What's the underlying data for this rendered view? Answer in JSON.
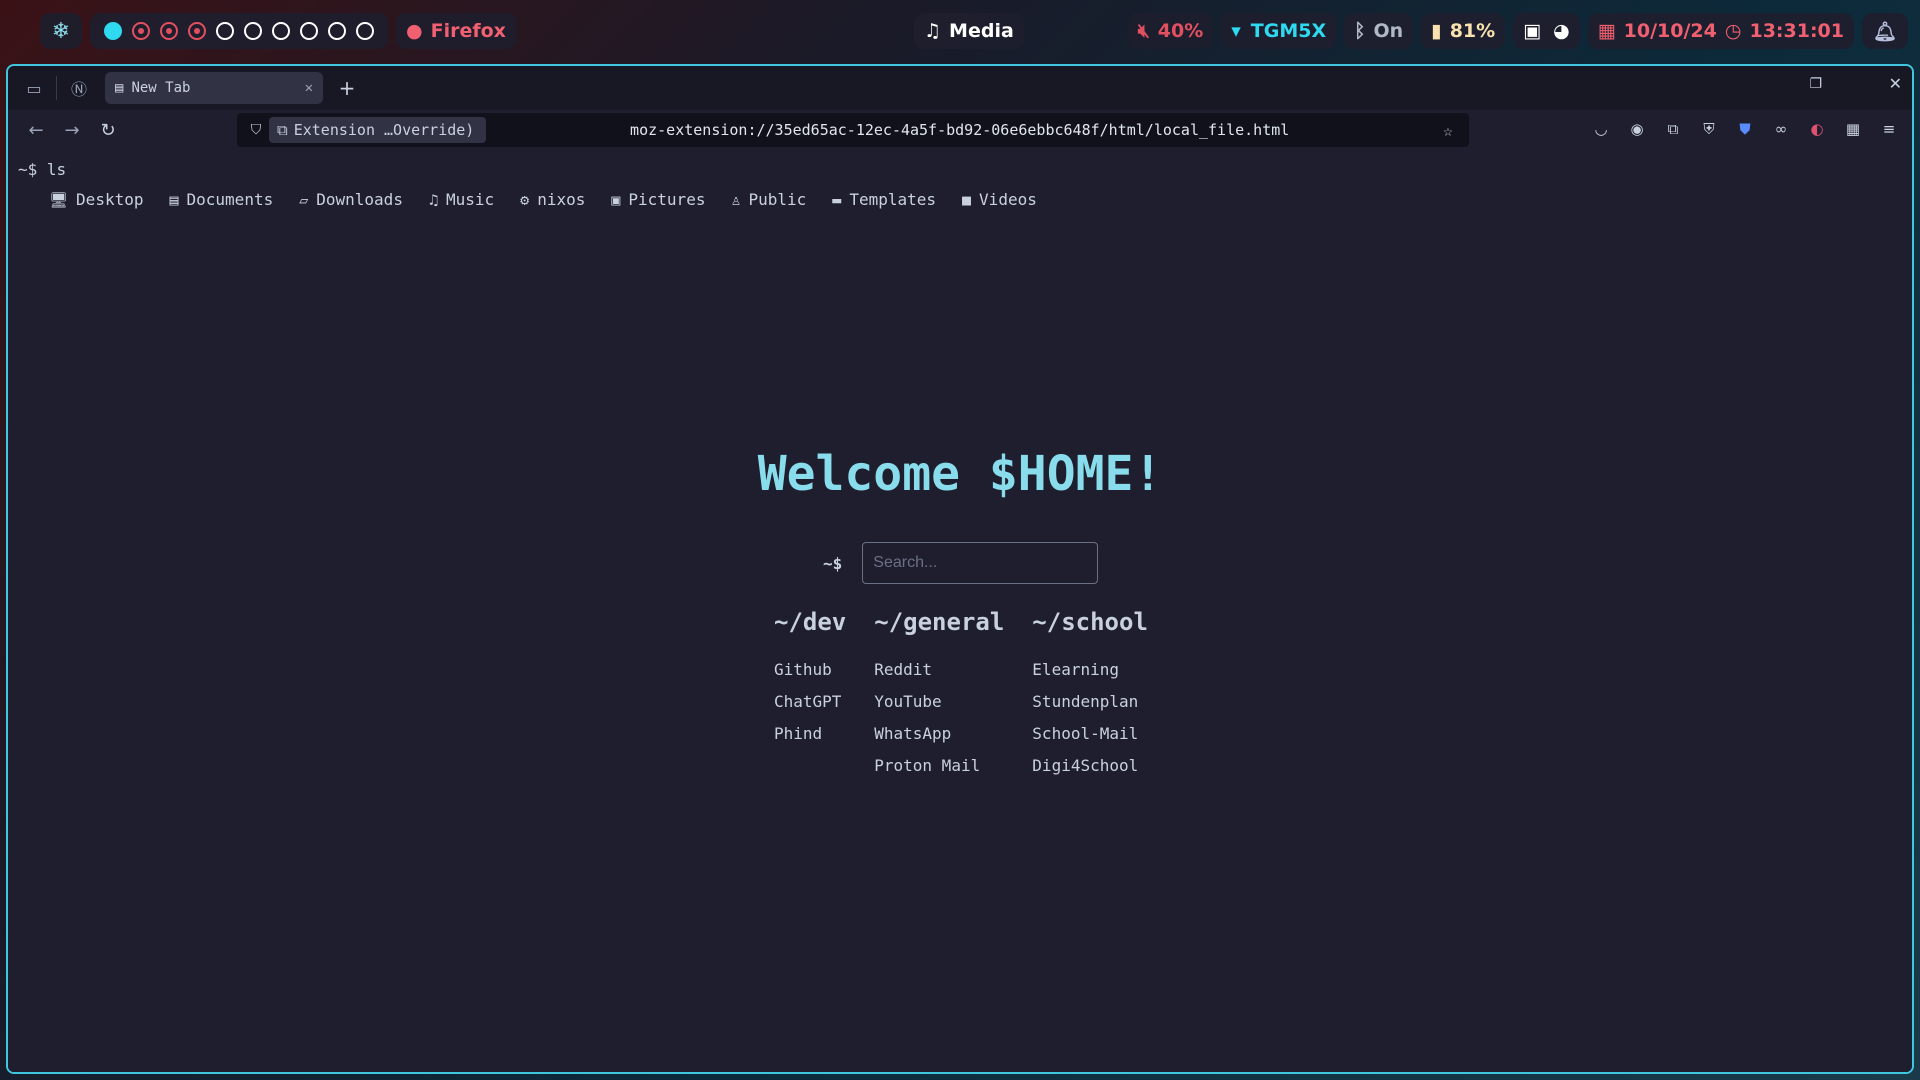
{
  "topbar": {
    "launcher_icon": "nixos-snowflake-icon",
    "workspaces": [
      "active",
      "occupied",
      "occupied",
      "occupied",
      "empty",
      "empty",
      "empty",
      "empty",
      "empty",
      "empty"
    ],
    "window_title": "Firefox",
    "media_label": "Media",
    "volume": "40%",
    "network": "TGM5X",
    "bluetooth": "On",
    "battery": "81%",
    "date": "10/10/24",
    "time": "13:31:01"
  },
  "browser": {
    "tab_title": "New Tab",
    "new_tab_symbol": "+",
    "identity_label": "Extension …Override)",
    "url": "moz-extension://35ed65ac-12ec-4a5f-bd92-06e6ebbc648f/html/local_file.html"
  },
  "page": {
    "prompt": "~$ ls",
    "dirs": [
      {
        "label": "Desktop",
        "icon": "monitor-icon"
      },
      {
        "label": "Documents",
        "icon": "document-icon"
      },
      {
        "label": "Downloads",
        "icon": "folder-open-icon"
      },
      {
        "label": "Music",
        "icon": "music-note-icon"
      },
      {
        "label": "nixos",
        "icon": "gear-icon"
      },
      {
        "label": "Pictures",
        "icon": "image-icon"
      },
      {
        "label": "Public",
        "icon": "user-icon"
      },
      {
        "label": "Templates",
        "icon": "folder-icon"
      },
      {
        "label": "Videos",
        "icon": "video-camera-icon"
      }
    ],
    "welcome": "Welcome $HOME!",
    "search_prompt": "~$",
    "search_placeholder": "Search...",
    "columns": [
      {
        "title": "~/dev",
        "links": [
          "Github",
          "ChatGPT",
          "Phind"
        ]
      },
      {
        "title": "~/general",
        "links": [
          "Reddit",
          "YouTube",
          "WhatsApp",
          "Proton Mail"
        ]
      },
      {
        "title": "~/school",
        "links": [
          "Elearning",
          "Stundenplan",
          "School-Mail",
          "Digi4School"
        ]
      }
    ]
  }
}
